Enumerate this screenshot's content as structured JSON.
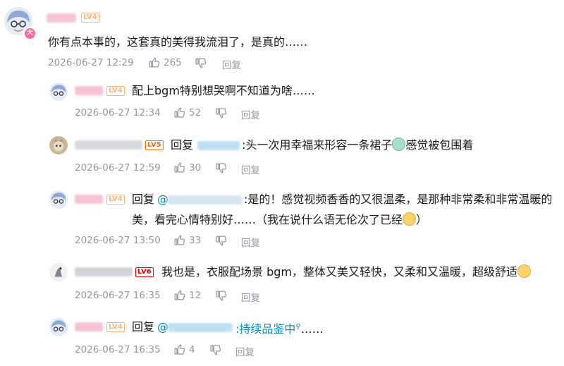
{
  "main_comment": {
    "text": "你有点本事的，这套真的美得我流泪了，是真的……",
    "time": "2026-06-27 12:29",
    "likes": "265",
    "reply_label": "回复",
    "level": "LV4"
  },
  "replies": [
    {
      "text": "配上bgm特别想哭啊不知道为啥……",
      "time": "2026-06-27 12:34",
      "likes": "52",
      "reply_label": "回复",
      "level": "LV4"
    },
    {
      "prefix": "回复",
      "text": ":头一次用幸福来形容一条裙子",
      "text_after": "感觉被包围着",
      "time": "2026-06-27 12:59",
      "likes": "30",
      "reply_label": "回复",
      "level": "LV5"
    },
    {
      "prefix": "回复",
      "mention": "@",
      "line1": ":是的！感觉视频香香的又很温柔，是那种非常柔和非常温暖的",
      "line2": "美，看完心情特别好……（我在说什么语无伦次了已经",
      "line2_end": "）",
      "time": "2026-06-27 13:50",
      "likes": "33",
      "reply_label": "回复",
      "level": "LV4"
    },
    {
      "text": "我也是，衣服配场景 bgm，整体又美又轻快，又柔和又温暖，超级舒适",
      "time": "2026-06-27 16:35",
      "likes": "12",
      "reply_label": "回复",
      "level": "LV6"
    },
    {
      "prefix": "回复",
      "mention": "@",
      "link_text": ":持续品鉴中",
      "text_after": "……",
      "time": "2026-06-27 16:35",
      "likes": "4",
      "reply_label": "回复",
      "level": "LV4"
    }
  ],
  "colors": {
    "meta": "#9499a0",
    "link": "#008ac5",
    "lv4": "#ffb37c",
    "lv5": "#ff6c00",
    "lv6": "#ff0000"
  }
}
